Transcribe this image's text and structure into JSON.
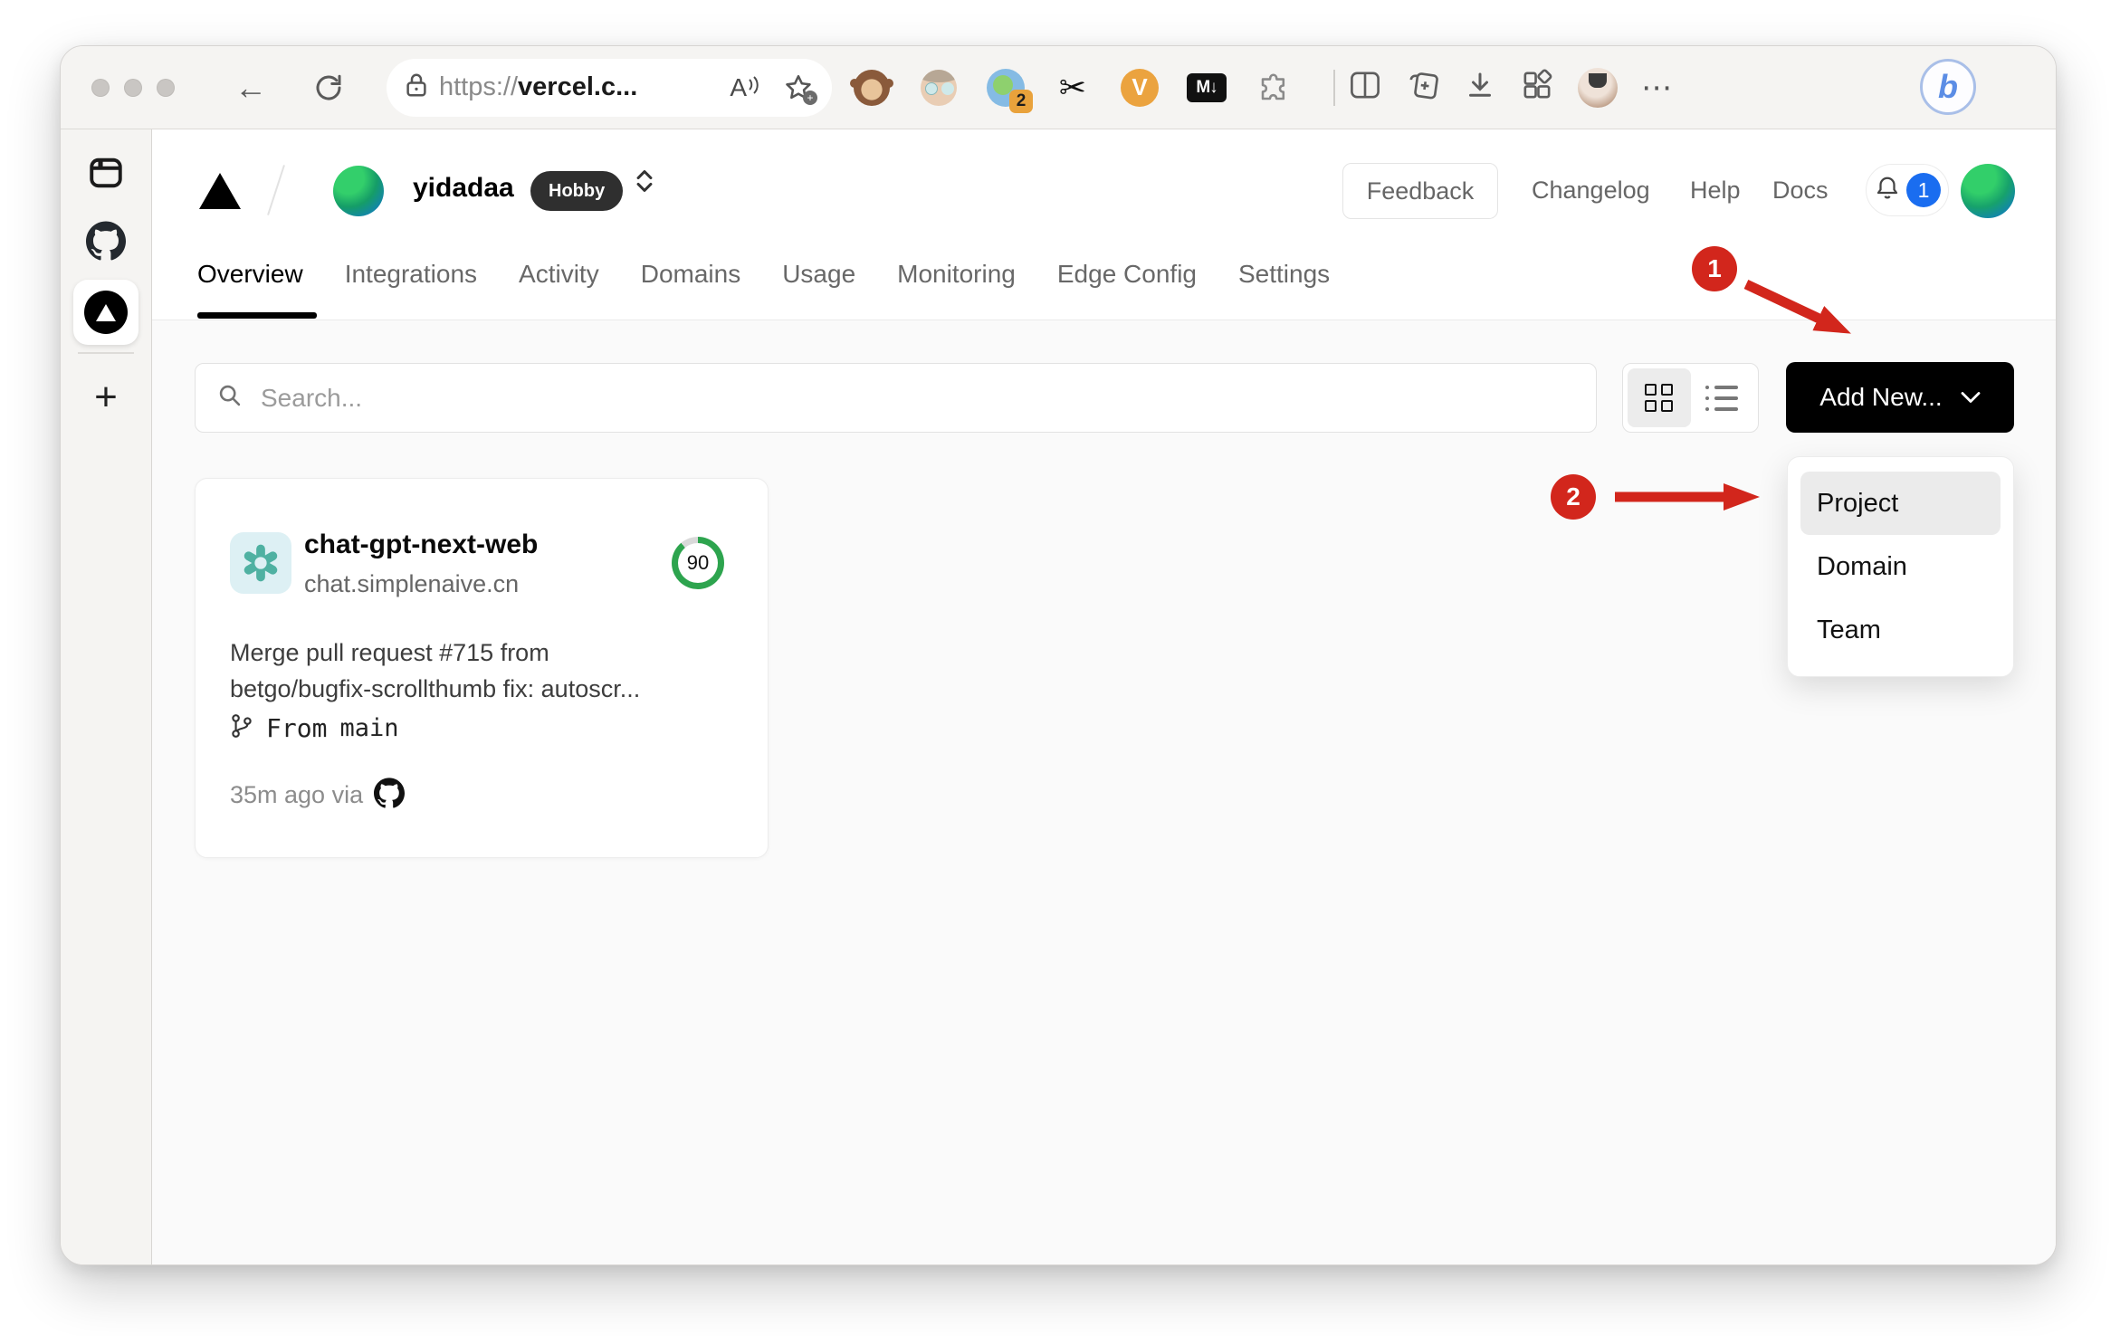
{
  "browser": {
    "url_scheme": "https://",
    "url_host": "vercel.c...",
    "reader_label": "A",
    "extension_badge": "2",
    "ext_v_label": "V",
    "ext_md_label": "M↓",
    "more_glyph": "⋯",
    "bing_label": "b",
    "back_glyph": "←",
    "scissors_glyph": "✂",
    "star_plus_glyph": "+"
  },
  "browser_sidebar": {
    "new_tab_glyph": "+"
  },
  "header": {
    "team_name": "yidadaa",
    "plan_badge": "Hobby",
    "feedback_label": "Feedback",
    "links": [
      "Changelog",
      "Help",
      "Docs"
    ],
    "notification_count": "1"
  },
  "tabs": [
    {
      "label": "Overview",
      "active": true
    },
    {
      "label": "Integrations"
    },
    {
      "label": "Activity"
    },
    {
      "label": "Domains"
    },
    {
      "label": "Usage"
    },
    {
      "label": "Monitoring"
    },
    {
      "label": "Edge Config"
    },
    {
      "label": "Settings"
    }
  ],
  "toolbar": {
    "search_placeholder": "Search...",
    "add_new_label": "Add New..."
  },
  "dropdown": {
    "items": [
      {
        "label": "Project",
        "highlighted": true
      },
      {
        "label": "Domain"
      },
      {
        "label": "Team"
      }
    ]
  },
  "annotations": {
    "step1": "1",
    "step2": "2"
  },
  "card": {
    "name": "chat-gpt-next-web",
    "domain": "chat.simplenaive.cn",
    "score": "90",
    "commit_line1": "Merge pull request #715 from",
    "commit_line2": "betgo/bugfix-scrollthumb fix: autoscr...",
    "branch_prefix": "From",
    "branch_name": "main",
    "meta": "35m ago via"
  },
  "colors": {
    "annotation_red": "#d2261c",
    "ring_green": "#2da44e",
    "notification_blue": "#1a6df0",
    "addnew_black": "#000000"
  }
}
